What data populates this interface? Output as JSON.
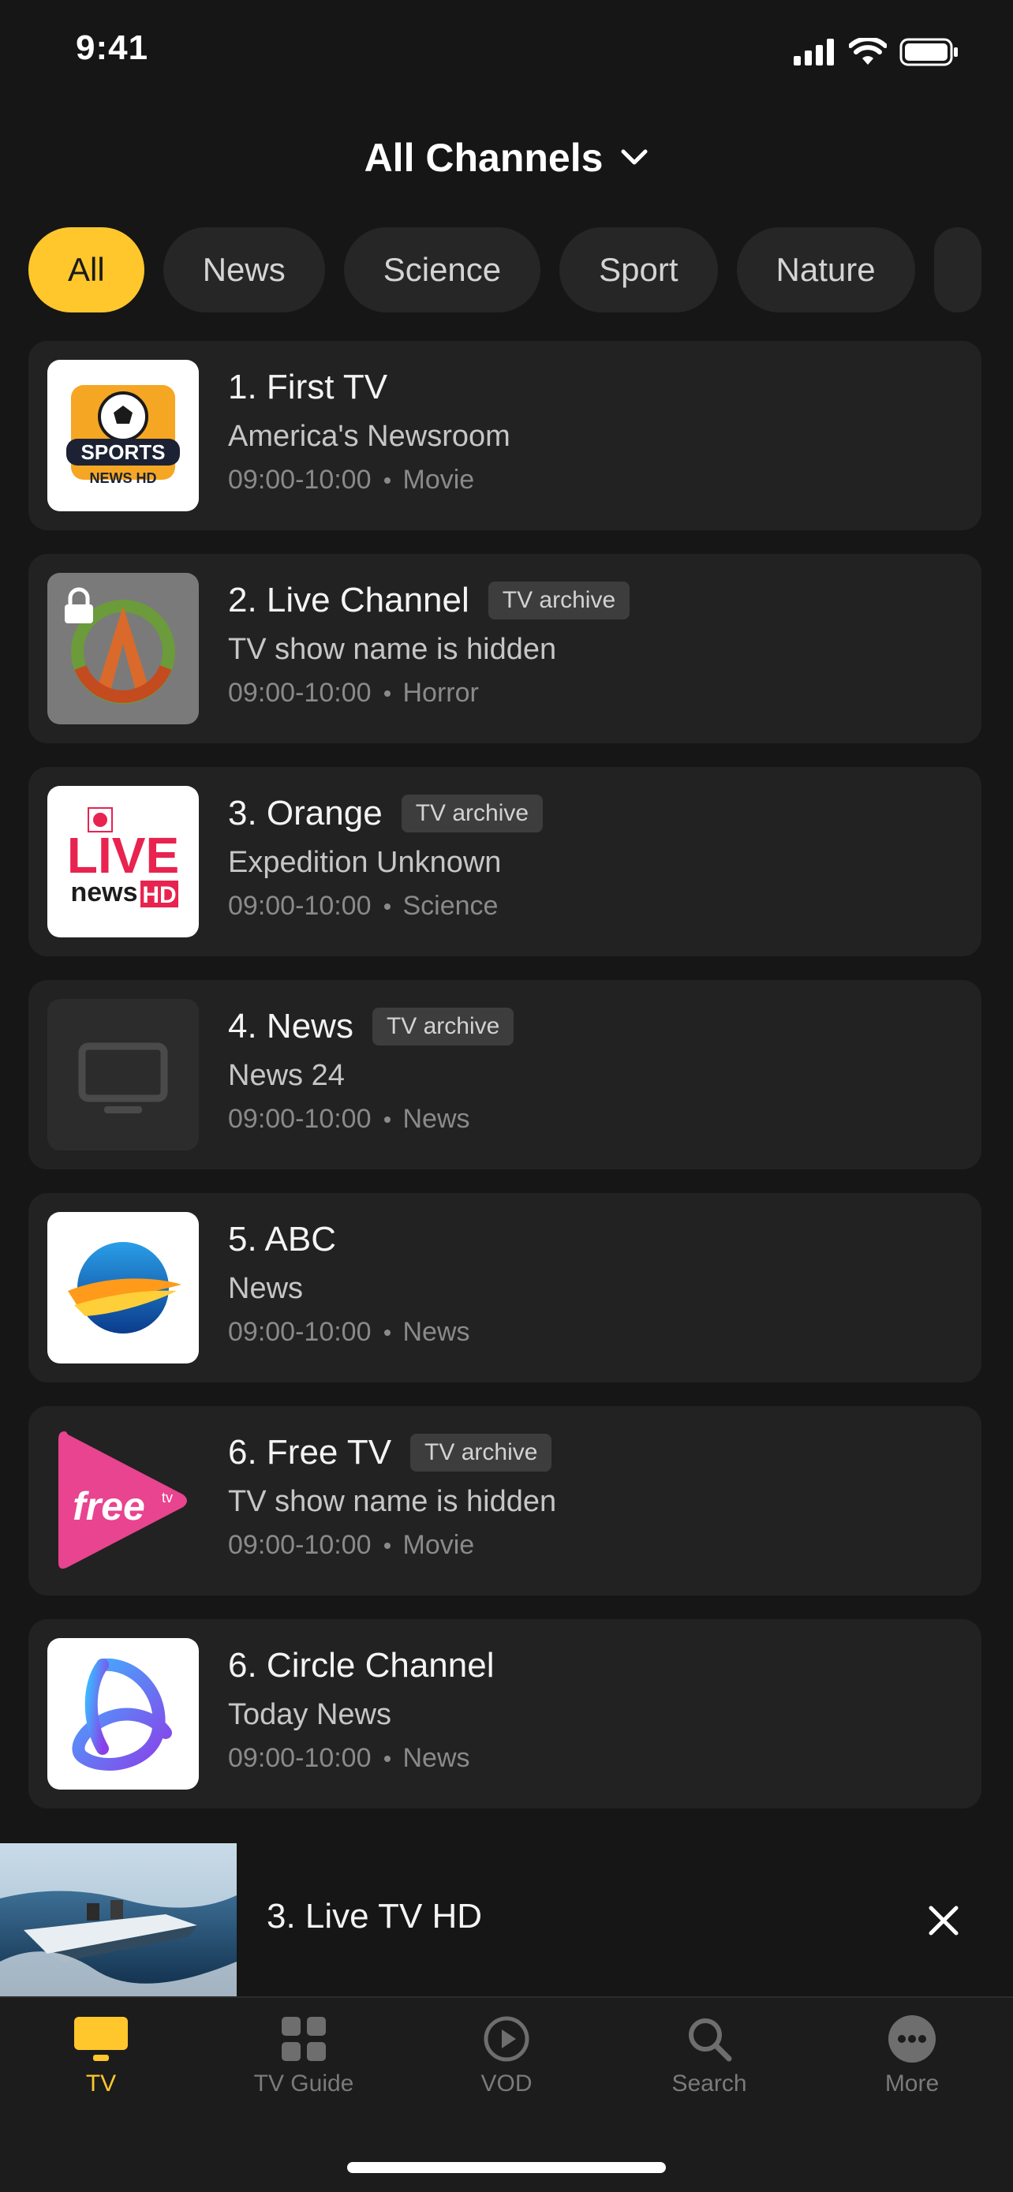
{
  "status_bar": {
    "time": "9:41"
  },
  "header": {
    "title": "All Channels"
  },
  "filters": [
    {
      "label": "All",
      "active": true
    },
    {
      "label": "News",
      "active": false
    },
    {
      "label": "Science",
      "active": false
    },
    {
      "label": "Sport",
      "active": false
    },
    {
      "label": "Nature",
      "active": false
    }
  ],
  "channels": [
    {
      "title": "1. First TV",
      "badge": "",
      "show": "America's Newsroom",
      "time": "09:00-10:00",
      "genre": "Movie",
      "logo": "sports-news-hd-logo",
      "locked": false
    },
    {
      "title": "2. Live Channel",
      "badge": "TV archive",
      "show": "TV show name is hidden",
      "time": "09:00-10:00",
      "genre": "Horror",
      "logo": "arc-logo",
      "locked": true
    },
    {
      "title": "3. Orange",
      "badge": "TV archive",
      "show": "Expedition Unknown",
      "time": "09:00-10:00",
      "genre": "Science",
      "logo": "live-news-hd-logo",
      "locked": false
    },
    {
      "title": "4. News",
      "badge": "TV archive",
      "show": "News 24",
      "time": "09:00-10:00",
      "genre": "News",
      "logo": "tv-placeholder-icon",
      "locked": false
    },
    {
      "title": "5. ABC",
      "badge": "",
      "show": "News",
      "time": "09:00-10:00",
      "genre": "News",
      "logo": "globe-swoosh-logo",
      "locked": false
    },
    {
      "title": "6. Free TV",
      "badge": "TV archive",
      "show": "TV show name is hidden",
      "time": "09:00-10:00",
      "genre": "Movie",
      "logo": "free-tv-logo",
      "locked": false
    },
    {
      "title": "6. Circle Channel",
      "badge": "",
      "show": "Today News",
      "time": "09:00-10:00",
      "genre": "News",
      "logo": "circle-channel-logo",
      "locked": false
    }
  ],
  "mini_player": {
    "title": "3. Live TV HD"
  },
  "tabs": [
    {
      "label": "TV",
      "icon": "tv-icon",
      "active": true
    },
    {
      "label": "TV Guide",
      "icon": "grid-icon",
      "active": false
    },
    {
      "label": "VOD",
      "icon": "play-circle-icon",
      "active": false
    },
    {
      "label": "Search",
      "icon": "search-icon",
      "active": false
    },
    {
      "label": "More",
      "icon": "more-icon",
      "active": false
    }
  ],
  "colors": {
    "accent": "#FFC72C",
    "background": "#161616",
    "card": "#222222"
  }
}
